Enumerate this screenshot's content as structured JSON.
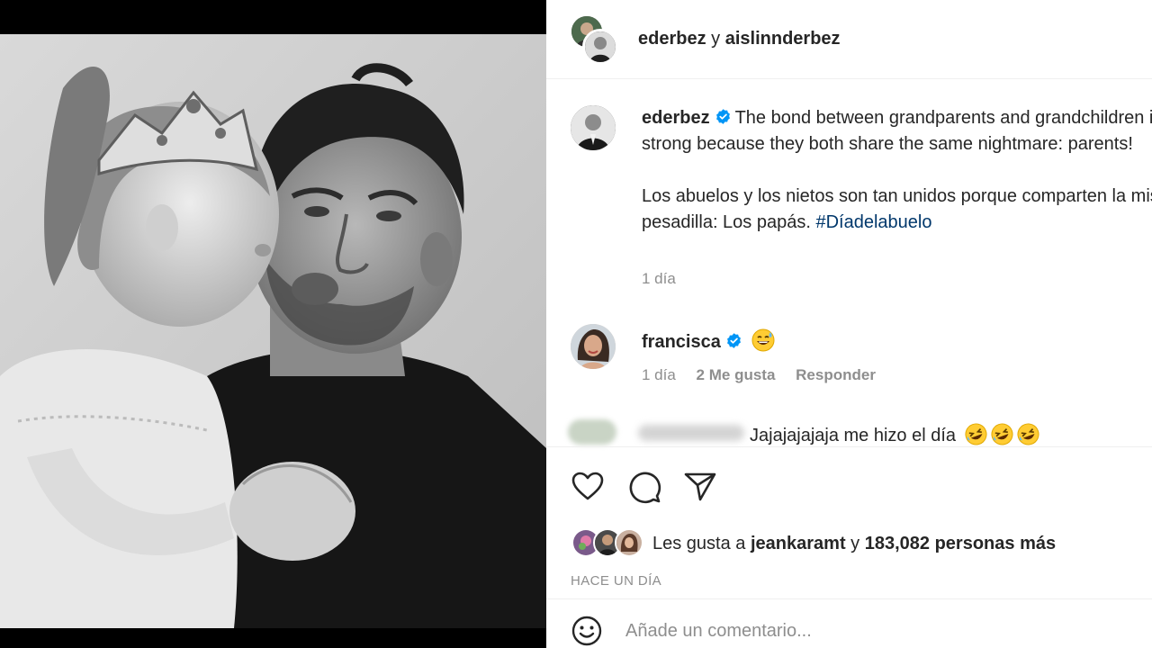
{
  "header": {
    "user1": "ederbez",
    "conjunction": "y",
    "user2": "aislinnderbez"
  },
  "caption": {
    "username": "ederbez",
    "verified_icon": "verified-badge-icon",
    "text_en": "The bond between grandparents and grandchildren is so strong because they both share the same nightmare: parents!",
    "text_es": "Los abuelos y los nietos son tan unidos porque comparten la misma pesadilla: Los papás.",
    "hashtag": "#Díadelabuelo",
    "time": "1 día"
  },
  "comments": [
    {
      "username": "francisca",
      "emoji": "grinning-sweat-emoji",
      "time": "1 día",
      "likes": "2 Me gusta",
      "reply": "Responder"
    },
    {
      "username": "",
      "text": "Jajajajajaja me hizo el día",
      "emoji": "rolling-laughing-emoji"
    }
  ],
  "actions": {
    "like_icon": "heart-icon",
    "comment_icon": "comment-icon",
    "share_icon": "share-icon"
  },
  "likes": {
    "prefix": "Les gusta a",
    "user": "jeankaramt",
    "conjunction": "y",
    "count_text": "183,082 personas más"
  },
  "posted_ago": "HACE UN DÍA",
  "add_comment": {
    "placeholder": "Añade un comentario...",
    "emoji_icon": "smiley-icon"
  },
  "colors": {
    "verified_blue": "#0095f6",
    "hashtag_blue": "#00376b",
    "muted_text": "#8e8e8e"
  }
}
